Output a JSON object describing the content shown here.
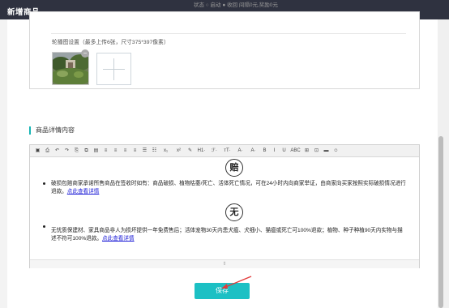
{
  "window": {
    "title": "新增商品"
  },
  "image_settings": {
    "partial_row": "状态 ○ 启动 ● 收回 间隔0元,奖励0元",
    "label": "轮播图设置（最多上传6张，尺寸375*397像素）",
    "delete_symbol": "−"
  },
  "details": {
    "section_title": "商品详情内容",
    "toolbar": {
      "items": [
        "▣",
        "⎙",
        "↶",
        "↷",
        "⎘",
        "⧉",
        "▤",
        "≡",
        "≡",
        "≡",
        "≡",
        "☰",
        "☷",
        "x₁",
        "x²",
        "✎",
        "H1·",
        "ℱ·",
        "ᴛT·",
        "A·",
        "A·",
        "B",
        "I",
        "U",
        "ABC",
        "⊞",
        "⊡",
        "▬",
        "☺"
      ]
    },
    "blocks": [
      {
        "badge": "赔",
        "text": "破损包赔商家承诺所售商品在签收时如有：商品破损、植物枯萎/死亡、活体死亡情况，可在24小时内向商家举证，由商家向买家按照实际破损情况进行退款。",
        "link": "点此查看详情"
      },
      {
        "badge": "无",
        "text": "无忧质保建材、家具商品非人为损坏提供一年免费售后；活体宠物30天内患犬瘟、犬细小、猫瘟或死亡可100%退款；植物、种子种植90天内实物与描述不符可100%退款。",
        "link": "点此查看详情"
      }
    ],
    "resize_handle": "⇕"
  },
  "actions": {
    "save_label": "保存"
  },
  "colors": {
    "accent": "#1cc0c4",
    "titlebar": "#2f3240",
    "link": "#1b1bd6"
  }
}
